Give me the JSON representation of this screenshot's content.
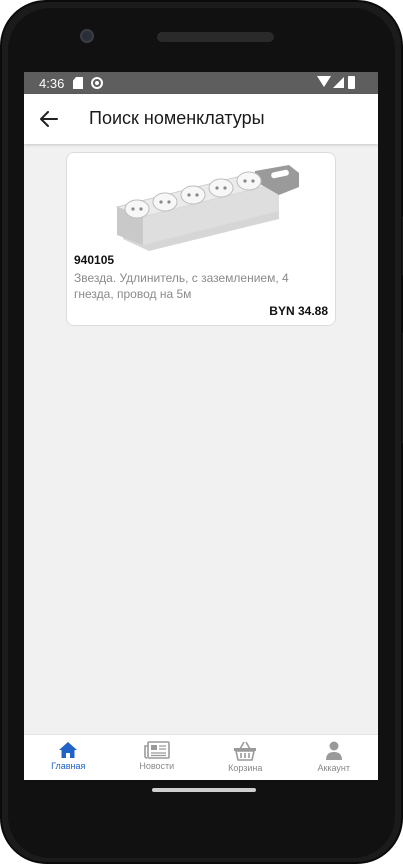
{
  "status_bar": {
    "time": "4:36"
  },
  "appbar": {
    "title": "Поиск номенклатуры"
  },
  "product": {
    "sku": "940105",
    "description": "Звезда. Удлинитель, с заземлением, 4 гнезда, провод на 5м",
    "price": "BYN 34.88",
    "image": "power-strip-image"
  },
  "bottom_nav": {
    "items": [
      {
        "label": "Главная",
        "icon": "home-icon",
        "active": true
      },
      {
        "label": "Новости",
        "icon": "newspaper-icon",
        "active": false
      },
      {
        "label": "Корзина",
        "icon": "basket-icon",
        "active": false
      },
      {
        "label": "Аккаунт",
        "icon": "user-icon",
        "active": false
      }
    ]
  },
  "colors": {
    "accent": "#1f62c8",
    "status_bar": "#5e5e5e",
    "background": "#f1f1f1"
  }
}
